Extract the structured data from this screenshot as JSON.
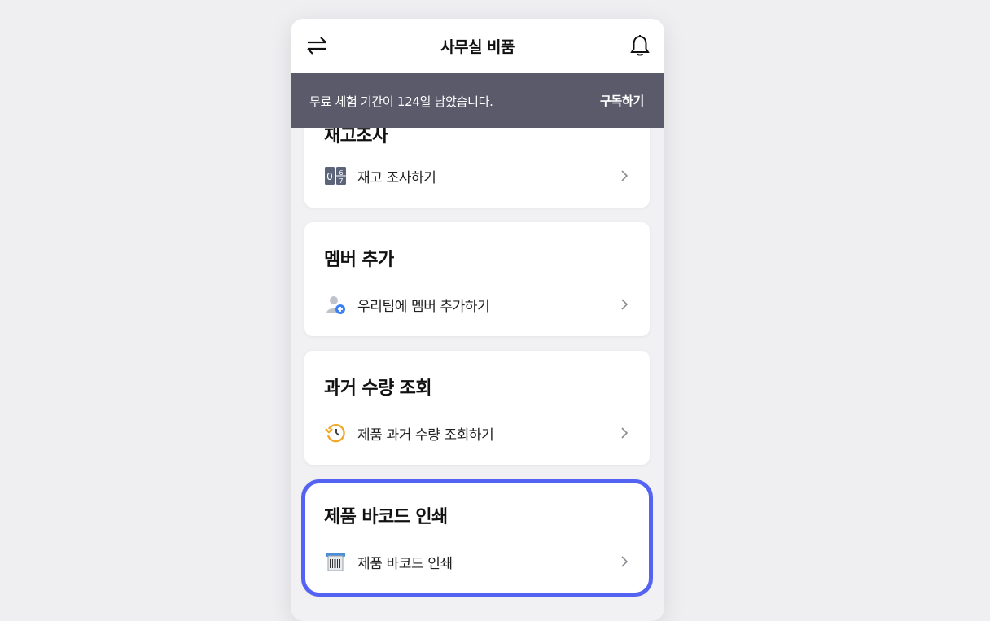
{
  "header": {
    "title": "사무실 비품",
    "swap_icon": "swap-arrows-icon",
    "bell_icon": "bell-icon"
  },
  "trial_banner": {
    "message": "무료 체험 기간이 124일 남았습니다.",
    "subscribe_label": "구독하기",
    "background": "#5a5a6b"
  },
  "cards": [
    {
      "title": "재고조사",
      "row": {
        "label": "재고 조사하기",
        "icon": "counter-icon"
      }
    },
    {
      "title": "멤버 추가",
      "row": {
        "label": "우리팀에 멤버 추가하기",
        "icon": "add-member-icon"
      }
    },
    {
      "title": "과거 수량 조회",
      "row": {
        "label": "제품 과거 수량 조회하기",
        "icon": "history-icon"
      }
    },
    {
      "title": "제품 바코드 인쇄",
      "row": {
        "label": "제품 바코드 인쇄",
        "icon": "barcode-print-icon"
      }
    }
  ],
  "colors": {
    "highlight": "#5563f2",
    "page_background": "#efeff2"
  }
}
